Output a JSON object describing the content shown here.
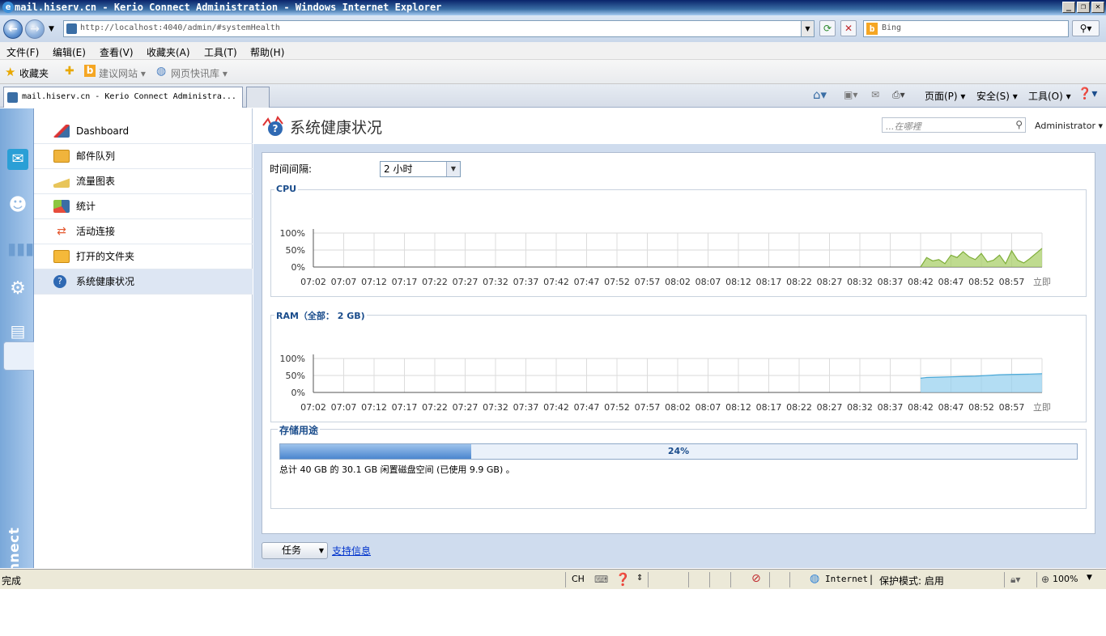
{
  "window": {
    "title": "mail.hiserv.cn - Kerio Connect Administration - Windows Internet Explorer",
    "url": "http://localhost:4040/admin/#systemHealth",
    "search_engine": "Bing"
  },
  "menu": [
    "文件(F)",
    "编辑(E)",
    "查看(V)",
    "收藏夹(A)",
    "工具(T)",
    "帮助(H)"
  ],
  "favorites": {
    "label": "收藏夹",
    "items": [
      "建议网站 ▾",
      "网页快讯库 ▾"
    ]
  },
  "tab": {
    "title": "mail.hiserv.cn - Kerio Connect Administra..."
  },
  "command_bar": [
    "页面(P) ▾",
    "安全(S) ▾",
    "工具(O) ▾"
  ],
  "brand": "KerioConnect",
  "nav": {
    "items": [
      {
        "label": "Dashboard",
        "icon": "dashboard-icon"
      },
      {
        "label": "邮件队列",
        "icon": "mail-queue-icon"
      },
      {
        "label": "流量图表",
        "icon": "traffic-chart-icon"
      },
      {
        "label": "统计",
        "icon": "statistics-icon"
      },
      {
        "label": "活动连接",
        "icon": "connections-icon"
      },
      {
        "label": "打开的文件夹",
        "icon": "folder-icon"
      },
      {
        "label": "系统健康状况",
        "icon": "system-health-icon"
      }
    ],
    "selected": "系统健康状况"
  },
  "header": {
    "title": "系统健康状况",
    "search_placeholder": "...在哪裡",
    "user": "Administrator ▾"
  },
  "interval": {
    "label": "时间间隔:",
    "value": "2 小时"
  },
  "time_ticks": [
    "07:02",
    "07:07",
    "07:12",
    "07:17",
    "07:22",
    "07:27",
    "07:32",
    "07:37",
    "07:42",
    "07:47",
    "07:52",
    "07:57",
    "08:02",
    "08:07",
    "08:12",
    "08:17",
    "08:22",
    "08:27",
    "08:32",
    "08:37",
    "08:42",
    "08:47",
    "08:52",
    "08:57",
    "立即"
  ],
  "chart_data": [
    {
      "type": "area",
      "title": "CPU",
      "ylabel": "",
      "yticks": [
        "100%",
        "50%",
        "0%"
      ],
      "ylim": [
        0,
        100
      ],
      "color": "#a9cf6a",
      "x": [
        "08:42",
        "08:43",
        "08:44",
        "08:45",
        "08:46",
        "08:47",
        "08:48",
        "08:49",
        "08:50",
        "08:51",
        "08:52",
        "08:53",
        "08:54",
        "08:55",
        "08:56",
        "08:57",
        "08:58",
        "08:59",
        "09:00",
        "09:01",
        "09:02"
      ],
      "values": [
        0,
        28,
        18,
        22,
        10,
        35,
        28,
        45,
        30,
        22,
        40,
        15,
        20,
        35,
        10,
        48,
        20,
        12,
        25,
        40,
        55
      ]
    },
    {
      "type": "area",
      "title": "RAM（全部： 2 GB)",
      "ylabel": "",
      "yticks": [
        "100%",
        "50%",
        "0%"
      ],
      "ylim": [
        0,
        100
      ],
      "color": "#9ad2ef",
      "x": [
        "08:42",
        "08:43",
        "08:45",
        "08:47",
        "08:49",
        "08:51",
        "08:53",
        "08:55",
        "08:57",
        "09:00",
        "09:02"
      ],
      "values": [
        42,
        44,
        45,
        46,
        47,
        48,
        50,
        52,
        53,
        54,
        55
      ]
    }
  ],
  "storage": {
    "title": "存储用途",
    "percent": 24,
    "percent_label": "24%",
    "text": "总计 40 GB 的 30.1 GB 闲置磁盘空间 (已使用 9.9 GB) 。"
  },
  "footer": {
    "tasks": "任务",
    "support": "支持信息"
  },
  "status": {
    "left": "完成",
    "ime": "CH",
    "zone": "Internet",
    "protected_mode": "保护模式: 启用",
    "zoom": "100%"
  }
}
